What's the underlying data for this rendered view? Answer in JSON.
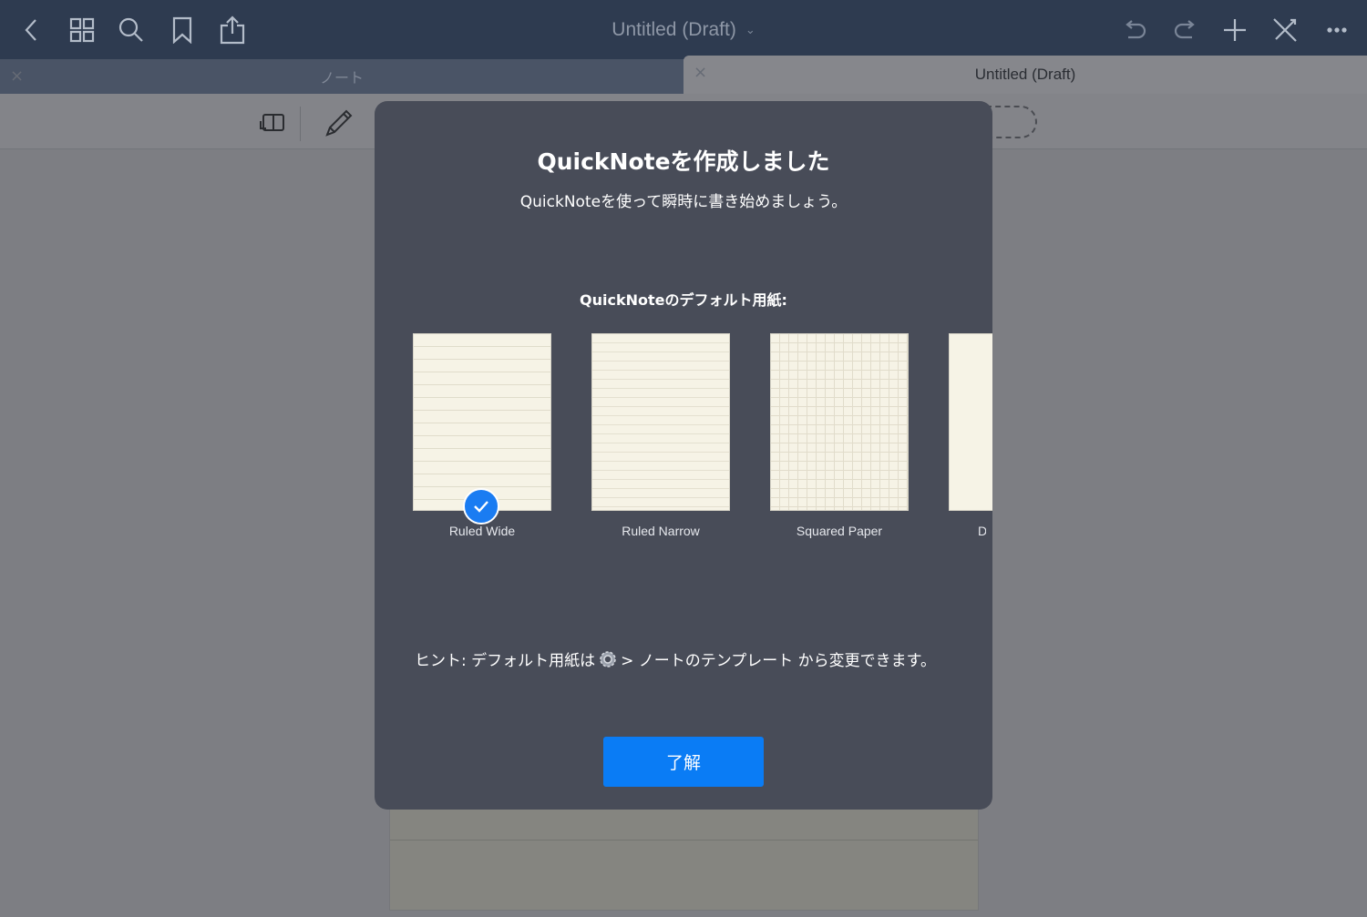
{
  "app": {
    "document_title": "Untitled (Draft)",
    "title_caret": "⌄"
  },
  "toolbar_left": [
    {
      "name": "back-icon"
    },
    {
      "name": "grid-icon"
    },
    {
      "name": "search-icon"
    },
    {
      "name": "bookmark-icon"
    },
    {
      "name": "share-icon"
    }
  ],
  "toolbar_right": [
    {
      "name": "undo-icon"
    },
    {
      "name": "redo-icon"
    },
    {
      "name": "add-icon"
    },
    {
      "name": "tools-off-icon"
    },
    {
      "name": "more-icon"
    }
  ],
  "tabs": [
    {
      "label": "ノート",
      "close": "×"
    },
    {
      "label": "Untitled (Draft)",
      "close": "×"
    }
  ],
  "tools": [
    {
      "name": "reading-mode-icon"
    },
    {
      "name": "pen-icon"
    },
    {
      "name": "lasso-icon"
    }
  ],
  "dialog": {
    "title": "QuickNoteを作成しました",
    "subtitle": "QuickNoteを使って瞬時に書き始めましょう。",
    "paper_heading": "QuickNoteのデフォルト用紙:",
    "papers": [
      {
        "label": "Ruled Wide",
        "selected": true
      },
      {
        "label": "Ruled Narrow",
        "selected": false
      },
      {
        "label": "Squared Paper",
        "selected": false
      },
      {
        "label": "Do",
        "selected": false
      }
    ],
    "hint_before": "ヒント: デフォルト用紙は",
    "hint_after": " > ノートのテンプレート から変更できます。",
    "ok_label": "了解"
  },
  "colors": {
    "topbar": "#2e3b50",
    "dialog_bg": "#484c58",
    "accent": "#0a7cf5",
    "paper": "#f6f3e6"
  }
}
